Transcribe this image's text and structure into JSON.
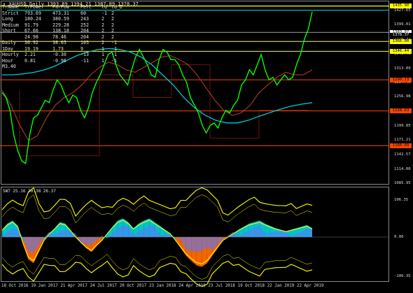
{
  "window": {
    "title": "XAUUSD,Daily  1393.89 1394.21 1387.89 1378.37"
  },
  "info_table": {
    "headers": [
      "TrName",
      "TrPower",
      "ParPow",
      "Perc",
      "td",
      "td_D"
    ],
    "rows": [
      [
        "Strict",
        "793.69",
        "473.31",
        "60",
        "-1",
        "2"
      ],
      [
        "Long",
        "180.24",
        "380.59",
        "243",
        "2",
        "2"
      ],
      [
        "Medium",
        "91.79",
        "229.28",
        "252",
        "2",
        "2"
      ],
      [
        "Short",
        "67.66",
        "138.18",
        "204",
        "2",
        "2"
      ],
      [
        "",
        "24.98",
        "78.46",
        "204",
        "2",
        "2"
      ],
      [
        "Daily",
        "36.92",
        "38.65",
        "105",
        "2",
        "-1"
      ],
      [
        "1Day",
        "19.19",
        "1.73",
        "9",
        "1",
        "-1"
      ],
      [
        "Hourly",
        "2.21",
        "-0.30",
        "-13",
        "1",
        "-1"
      ],
      [
        "Hour",
        "0.81",
        "-0.96",
        "-11",
        "1",
        "-1"
      ],
      [
        "M3.40",
        "",
        "",
        "",
        "",
        ""
      ]
    ]
  },
  "price_axis": {
    "labels": [
      "1427.65",
      "1399.01",
      "1370.37",
      "1341.73",
      "1313.09",
      "1284.45",
      "1256.98",
      "1227.90",
      "1199.85",
      "1171.21",
      "1142.57",
      "1114.00",
      "1085.95"
    ],
    "tags": [
      {
        "text": "1435.90",
        "bg": "#ffff00",
        "fg": "#000000"
      },
      {
        "text": "1383.97",
        "bg": "#ffffff",
        "fg": "#000000"
      },
      {
        "text": "1378.37",
        "bg": "#000000",
        "fg": "#ffffff"
      },
      {
        "text": "1366.00",
        "bg": "#ffff00",
        "fg": "#000000"
      },
      {
        "text": "1346.44",
        "bg": "#ffff00",
        "fg": "#000000"
      },
      {
        "text": "1290.13",
        "bg": "#ff4500",
        "fg": "#000000"
      },
      {
        "text": "1228.63",
        "bg": "#ff4500",
        "fg": "#000000"
      },
      {
        "text": "1160.09",
        "bg": "#ff4500",
        "fg": "#000000"
      }
    ]
  },
  "oscillator": {
    "title": "SWT 25.16 30.38 26.37",
    "axis_labels": [
      "106.35",
      "0.00",
      "-106.35"
    ]
  },
  "time_axis": {
    "labels": [
      "18 Oct 2016",
      "19 Jan 2017",
      "21 Apr 2017",
      "24 Jul 2017",
      "20 Oct 2017",
      "23 Jan 2018",
      "24 Apr 2018",
      "23 Jul 2018",
      "19 Oct 2018",
      "22 Jan 2019",
      "22 Apr 2019"
    ]
  },
  "colors": {
    "price_line": "#00ff00",
    "ma_slow": "#00c8d6",
    "ma_fast": "#c0402a",
    "level_red": "#ff4500",
    "level_yellow": "#ffff00",
    "osc_orange": "#ff6a00",
    "osc_cyan": "#00d0d0",
    "osc_blue": "#5a78ff",
    "band_yellow": "#ffff00"
  },
  "chart_data": {
    "type": "line",
    "ylim": [
      1085.95,
      1445
    ],
    "series": [
      {
        "name": "XAUUSD",
        "values": [
          1265,
          1255,
          1230,
          1180,
          1150,
          1130,
          1125,
          1180,
          1215,
          1220,
          1235,
          1250,
          1245,
          1270,
          1290,
          1280,
          1260,
          1245,
          1260,
          1255,
          1230,
          1215,
          1235,
          1265,
          1285,
          1300,
          1320,
          1340,
          1345,
          1320,
          1300,
          1290,
          1280,
          1310,
          1335,
          1350,
          1335,
          1320,
          1300,
          1295,
          1330,
          1350,
          1345,
          1330,
          1330,
          1320,
          1300,
          1285,
          1255,
          1240,
          1225,
          1200,
          1185,
          1200,
          1205,
          1195,
          1215,
          1230,
          1225,
          1240,
          1250,
          1280,
          1290,
          1310,
          1300,
          1320,
          1340,
          1310,
          1290,
          1295,
          1280,
          1290,
          1300,
          1290,
          1295,
          1320,
          1340,
          1370,
          1390,
          1425
        ]
      }
    ]
  }
}
